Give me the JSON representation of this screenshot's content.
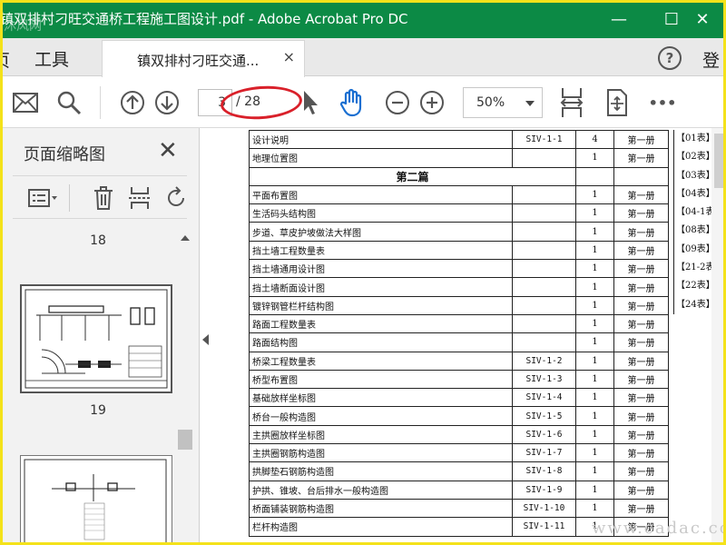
{
  "window": {
    "title": "镇双排村刁旺交通桥工程施工图设计.pdf - Adobe Acrobat Pro DC",
    "minimize": "—",
    "maximize": "☐",
    "close": "✕"
  },
  "tabs": {
    "home_partial": "页",
    "tools": "工具",
    "doc_tab": "镇双排村刁旺交通...",
    "doc_close": "×",
    "help": "?",
    "login_partial": "登"
  },
  "toolbar": {
    "current_page": "3",
    "total_pages": "/ 28",
    "zoom": "50%",
    "more": "•••",
    "highlight_color": "#d9202a",
    "icons": [
      "email-icon",
      "search-icon",
      "prev-page-icon",
      "next-page-icon",
      "select-cursor-icon",
      "hand-tool-icon",
      "zoom-out-icon",
      "zoom-in-icon",
      "fit-width-icon",
      "fit-page-icon",
      "more-icon"
    ]
  },
  "thumbnails_panel": {
    "title": "页面缩略图",
    "close": "✕",
    "pages": [
      {
        "label": "18"
      },
      {
        "label": "19"
      }
    ]
  },
  "document": {
    "rows": [
      {
        "name": "设计说明",
        "code": "SIV-1-1",
        "qty": "4",
        "vol": "第一册"
      },
      {
        "name": "地理位置图",
        "code": "",
        "qty": "1",
        "vol": "第一册"
      },
      {
        "name": "第二篇",
        "section": true
      },
      {
        "name": "平面布置图",
        "code": "",
        "qty": "1",
        "vol": "第一册"
      },
      {
        "name": "生活码头结构图",
        "code": "",
        "qty": "1",
        "vol": "第一册"
      },
      {
        "name": "步道、草皮护坡做法大样图",
        "code": "",
        "qty": "1",
        "vol": "第一册"
      },
      {
        "name": "挡土墙工程数量表",
        "code": "",
        "qty": "1",
        "vol": "第一册"
      },
      {
        "name": "挡土墙通用设计图",
        "code": "",
        "qty": "1",
        "vol": "第一册"
      },
      {
        "name": "挡土墙断面设计图",
        "code": "",
        "qty": "1",
        "vol": "第一册"
      },
      {
        "name": "镀锌钢管栏杆结构图",
        "code": "",
        "qty": "1",
        "vol": "第一册"
      },
      {
        "name": "路面工程数量表",
        "code": "",
        "qty": "1",
        "vol": "第一册"
      },
      {
        "name": "路面结构图",
        "code": "",
        "qty": "1",
        "vol": "第一册"
      },
      {
        "name": "桥梁工程数量表",
        "code": "SIV-1-2",
        "qty": "1",
        "vol": "第一册"
      },
      {
        "name": "桥型布置图",
        "code": "SIV-1-3",
        "qty": "1",
        "vol": "第一册"
      },
      {
        "name": "基础放样坐标图",
        "code": "SIV-1-4",
        "qty": "1",
        "vol": "第一册"
      },
      {
        "name": "桥台一般构造图",
        "code": "SIV-1-5",
        "qty": "1",
        "vol": "第一册"
      },
      {
        "name": "主拱圈放样坐标图",
        "code": "SIV-1-6",
        "qty": "1",
        "vol": "第一册"
      },
      {
        "name": "主拱圈钢筋构造图",
        "code": "SIV-1-7",
        "qty": "1",
        "vol": "第一册"
      },
      {
        "name": "拱脚垫石钢筋构造图",
        "code": "SIV-1-8",
        "qty": "1",
        "vol": "第一册"
      },
      {
        "name": "护拱、锥坡、台后排水一般构造图",
        "code": "SIV-1-9",
        "qty": "1",
        "vol": "第一册"
      },
      {
        "name": "桥面铺装钢筋构造图",
        "code": "SIV-1-10",
        "qty": "1",
        "vol": "第一册"
      },
      {
        "name": "栏杆构造图",
        "code": "SIV-1-11",
        "qty": "1",
        "vol": "第一册"
      }
    ],
    "side_refs": [
      "【01表】",
      "【02表】",
      "【03表】",
      "【04表】",
      "【04-1表",
      "【08表】",
      "【09表】",
      "【21-2表",
      "【22表】",
      "【24表】"
    ]
  },
  "watermark": {
    "bottom_right": "www.cadac.com",
    "top_left": "沐风网"
  }
}
